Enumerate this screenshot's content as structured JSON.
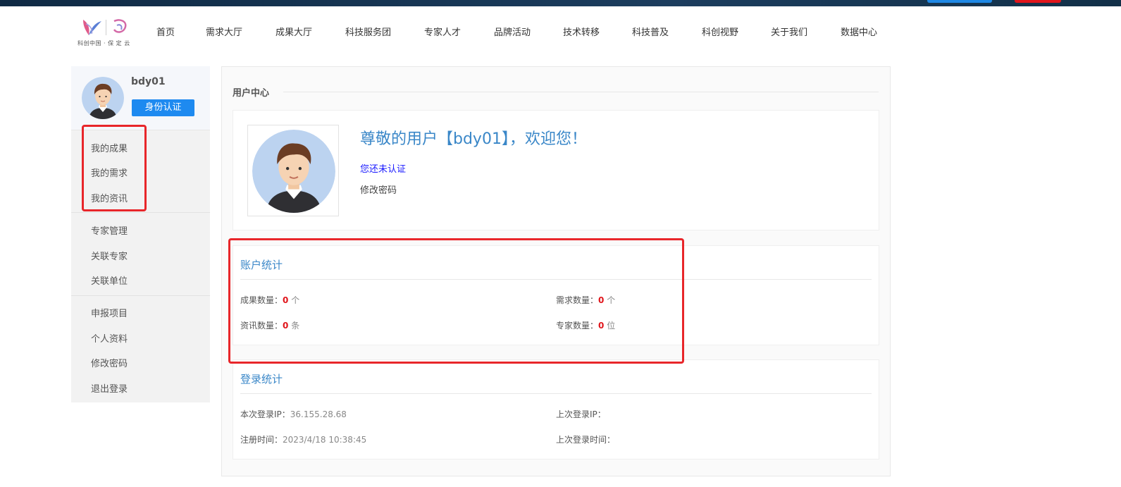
{
  "brand": {
    "logo_caption": "科创中国 · 保 定 云"
  },
  "nav": {
    "items": [
      "首页",
      "需求大厅",
      "成果大厅",
      "科技服务团",
      "专家人才",
      "品牌活动",
      "技术转移",
      "科技普及",
      "科创视野",
      "关于我们",
      "数据中心"
    ]
  },
  "sidebar": {
    "username": "bdy01",
    "verify_button": "身份认证",
    "groups": [
      [
        "我的成果",
        "我的需求",
        "我的资讯"
      ],
      [
        "专家管理",
        "关联专家",
        "关联单位"
      ],
      [
        "申报项目",
        "个人资料",
        "修改密码",
        "退出登录"
      ]
    ]
  },
  "main": {
    "title": "用户中心",
    "welcome": "尊敬的用户【bdy01】，欢迎您！",
    "not_verified": "您还未认证",
    "change_password": "修改密码"
  },
  "account_stats": {
    "title": "账户统计",
    "results_label": "成果数量：",
    "results_value": "0",
    "results_unit": "个",
    "demands_label": "需求数量：",
    "demands_value": "0",
    "demands_unit": "个",
    "news_label": "资讯数量：",
    "news_value": "0",
    "news_unit": "条",
    "experts_label": "专家数量：",
    "experts_value": "0",
    "experts_unit": "位"
  },
  "login_stats": {
    "title": "登录统计",
    "current_ip_label": "本次登录IP：",
    "current_ip": "36.155.28.68",
    "last_ip_label": "上次登录IP：",
    "last_ip": "",
    "register_label": "注册时间：",
    "register_time": "2023/4/18 10:38:45",
    "last_login_label": "上次登录时间：",
    "last_login_time": ""
  },
  "colors": {
    "accent_blue": "#1e8af0",
    "title_blue": "#3a87c8",
    "highlight_red": "#e8262a",
    "number_red": "#e0151b"
  }
}
